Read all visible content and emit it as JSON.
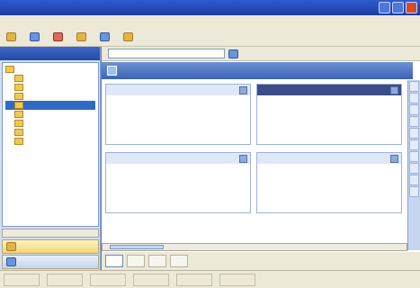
{
  "window": {
    "title": ""
  },
  "menu": [
    "",
    "",
    "",
    "",
    ""
  ],
  "toolbar": {
    "buttons": [
      "",
      "",
      "",
      "",
      "",
      ""
    ]
  },
  "sidebar": {
    "header": "",
    "tree": [
      "",
      "",
      "",
      "",
      "",
      "",
      "",
      "",
      ""
    ],
    "button1": "",
    "button2": ""
  },
  "filter": {
    "label": "",
    "input_value": "",
    "advanced": ""
  },
  "header": {
    "title": ""
  },
  "cards": [
    {
      "title": "",
      "rows": [
        {
          "k": "",
          "v": ""
        },
        {
          "k": "",
          "v": ""
        },
        {
          "k": "",
          "v": ""
        },
        {
          "k": "",
          "v": ""
        }
      ]
    },
    {
      "title": "",
      "rows": [
        {
          "k": "",
          "v": ""
        },
        {
          "k": "",
          "v": ""
        },
        {
          "k": "",
          "v": ""
        },
        {
          "k": "",
          "v": ""
        }
      ]
    },
    {
      "title": "",
      "rows": [
        {
          "k": "",
          "v": ""
        },
        {
          "k": "",
          "v": ""
        },
        {
          "k": "",
          "v": ""
        },
        {
          "k": "",
          "v": ""
        }
      ]
    },
    {
      "title": "",
      "rows": [
        {
          "k": "",
          "v": ""
        },
        {
          "k": "",
          "v": ""
        },
        {
          "k": "",
          "v": ""
        },
        {
          "k": "",
          "v": ""
        }
      ]
    }
  ],
  "view_tabs": [
    "",
    "",
    "",
    ""
  ],
  "status": [
    "",
    "",
    "",
    "",
    "",
    ""
  ],
  "colors": {
    "title_bar": "#2f5bd0",
    "header": "#3d63b5",
    "sidebar": "#d4dff3"
  }
}
